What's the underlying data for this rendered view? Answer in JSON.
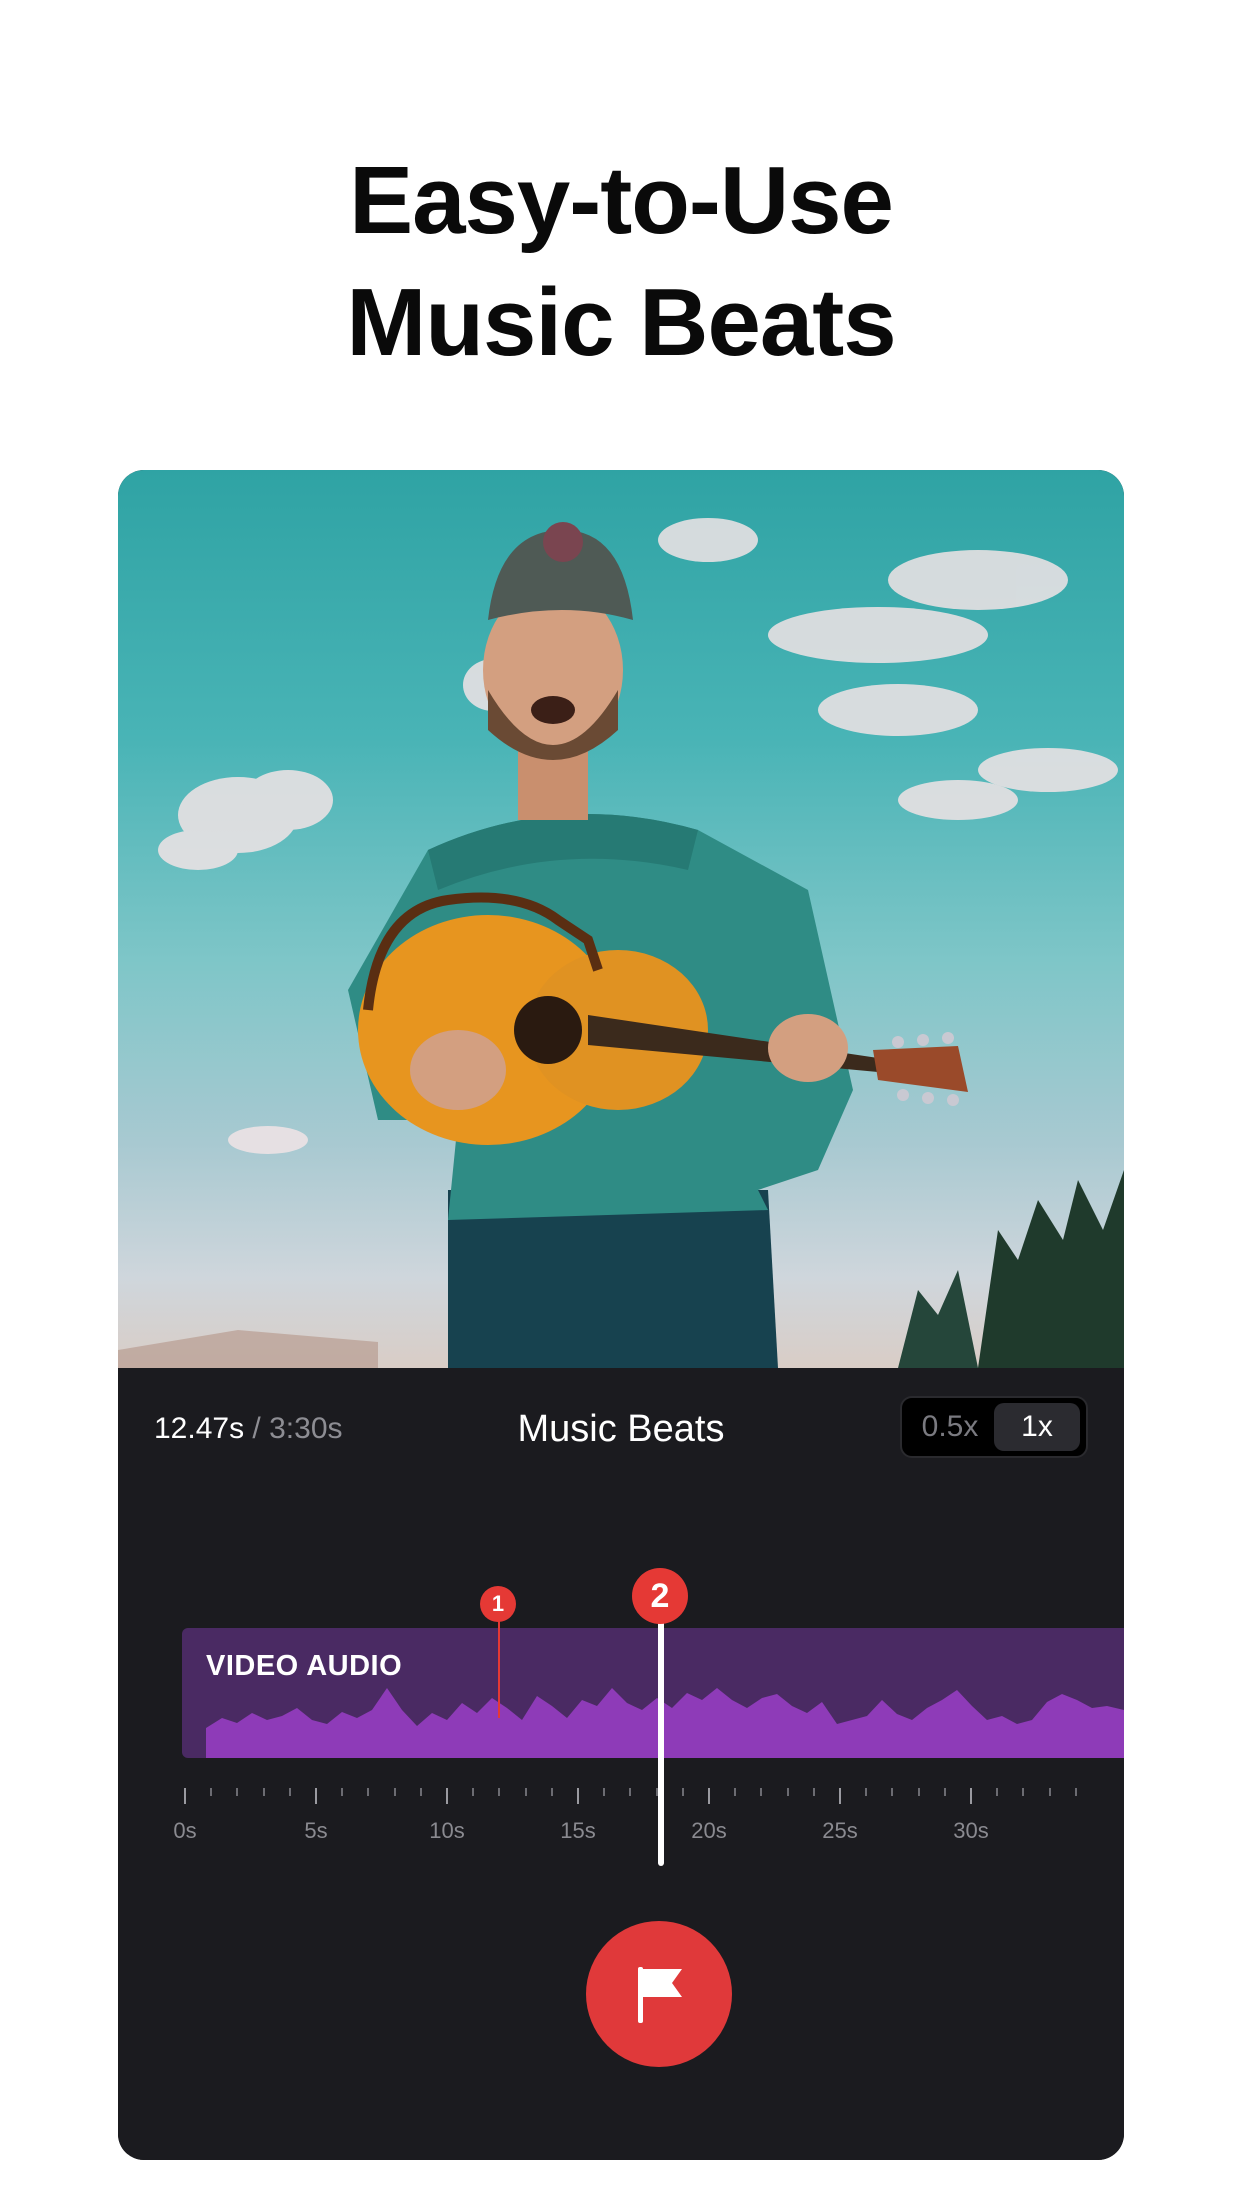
{
  "headline": {
    "line1": "Easy-to-Use",
    "line2": "Music Beats"
  },
  "player": {
    "current_time": "12.47s",
    "separator": "/",
    "total_time": "3:30s",
    "title": "Music Beats",
    "speed_options": [
      "0.5x",
      "1x"
    ],
    "selected_speed": "1x"
  },
  "timeline": {
    "track_label": "VIDEO AUDIO",
    "beat_markers": [
      "1",
      "2"
    ],
    "ruler_labels": [
      "0s",
      "5s",
      "10s",
      "15s",
      "20s",
      "25s",
      "30s"
    ],
    "playhead_position_s": 17.9,
    "beat1_position_s": 12.0
  },
  "colors": {
    "accent_red": "#e53935",
    "track_bg": "#4a2a63",
    "waveform": "#8e3bb8",
    "panel_bg": "#1b1b1f"
  },
  "icons": {
    "flag": "flag-icon"
  }
}
